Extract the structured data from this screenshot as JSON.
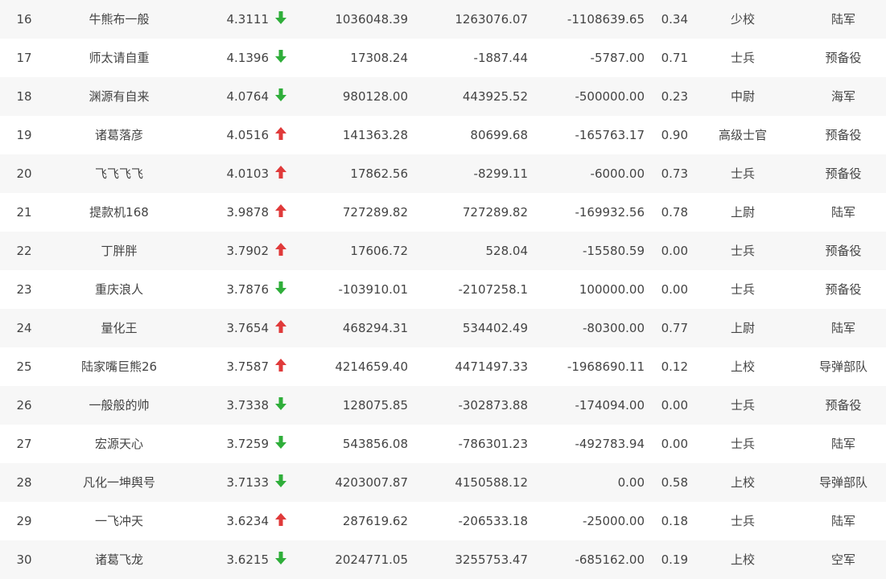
{
  "colors": {
    "up": "#e03a3a",
    "down": "#2fae3a",
    "text": "#444444",
    "row_alt": "#f7f7f7"
  },
  "rows": [
    {
      "rank": "16",
      "name": "牛熊布一般",
      "score": "4.3111",
      "trend": "down",
      "v1": "1036048.39",
      "v2": "1263076.07",
      "v3": "-1108639.65",
      "ratio": "0.34",
      "military_rank": "少校",
      "branch": "陆军"
    },
    {
      "rank": "17",
      "name": "师太请自重",
      "score": "4.1396",
      "trend": "down",
      "v1": "17308.24",
      "v2": "-1887.44",
      "v3": "-5787.00",
      "ratio": "0.71",
      "military_rank": "士兵",
      "branch": "预备役"
    },
    {
      "rank": "18",
      "name": "渊源有自来",
      "score": "4.0764",
      "trend": "down",
      "v1": "980128.00",
      "v2": "443925.52",
      "v3": "-500000.00",
      "ratio": "0.23",
      "military_rank": "中尉",
      "branch": "海军"
    },
    {
      "rank": "19",
      "name": "诸葛落彦",
      "score": "4.0516",
      "trend": "up",
      "v1": "141363.28",
      "v2": "80699.68",
      "v3": "-165763.17",
      "ratio": "0.90",
      "military_rank": "高级士官",
      "branch": "预备役"
    },
    {
      "rank": "20",
      "name": "飞飞飞飞",
      "score": "4.0103",
      "trend": "up",
      "v1": "17862.56",
      "v2": "-8299.11",
      "v3": "-6000.00",
      "ratio": "0.73",
      "military_rank": "士兵",
      "branch": "预备役"
    },
    {
      "rank": "21",
      "name": "提款机168",
      "score": "3.9878",
      "trend": "up",
      "v1": "727289.82",
      "v2": "727289.82",
      "v3": "-169932.56",
      "ratio": "0.78",
      "military_rank": "上尉",
      "branch": "陆军"
    },
    {
      "rank": "22",
      "name": "丁胖胖",
      "score": "3.7902",
      "trend": "up",
      "v1": "17606.72",
      "v2": "528.04",
      "v3": "-15580.59",
      "ratio": "0.00",
      "military_rank": "士兵",
      "branch": "预备役"
    },
    {
      "rank": "23",
      "name": "重庆浪人",
      "score": "3.7876",
      "trend": "down",
      "v1": "-103910.01",
      "v2": "-2107258.1",
      "v3": "100000.00",
      "ratio": "0.00",
      "military_rank": "士兵",
      "branch": "预备役"
    },
    {
      "rank": "24",
      "name": "量化王",
      "score": "3.7654",
      "trend": "up",
      "v1": "468294.31",
      "v2": "534402.49",
      "v3": "-80300.00",
      "ratio": "0.77",
      "military_rank": "上尉",
      "branch": "陆军"
    },
    {
      "rank": "25",
      "name": "陆家嘴巨熊26",
      "score": "3.7587",
      "trend": "up",
      "v1": "4214659.40",
      "v2": "4471497.33",
      "v3": "-1968690.11",
      "ratio": "0.12",
      "military_rank": "上校",
      "branch": "导弹部队"
    },
    {
      "rank": "26",
      "name": "一般般的帅",
      "score": "3.7338",
      "trend": "down",
      "v1": "128075.85",
      "v2": "-302873.88",
      "v3": "-174094.00",
      "ratio": "0.00",
      "military_rank": "士兵",
      "branch": "预备役"
    },
    {
      "rank": "27",
      "name": "宏源天心",
      "score": "3.7259",
      "trend": "down",
      "v1": "543856.08",
      "v2": "-786301.23",
      "v3": "-492783.94",
      "ratio": "0.00",
      "military_rank": "士兵",
      "branch": "陆军"
    },
    {
      "rank": "28",
      "name": "凡化一坤舆号",
      "score": "3.7133",
      "trend": "down",
      "v1": "4203007.87",
      "v2": "4150588.12",
      "v3": "0.00",
      "ratio": "0.58",
      "military_rank": "上校",
      "branch": "导弹部队"
    },
    {
      "rank": "29",
      "name": "一飞冲天",
      "score": "3.6234",
      "trend": "up",
      "v1": "287619.62",
      "v2": "-206533.18",
      "v3": "-25000.00",
      "ratio": "0.18",
      "military_rank": "士兵",
      "branch": "陆军"
    },
    {
      "rank": "30",
      "name": "诸葛飞龙",
      "score": "3.6215",
      "trend": "down",
      "v1": "2024771.05",
      "v2": "3255753.47",
      "v3": "-685162.00",
      "ratio": "0.19",
      "military_rank": "上校",
      "branch": "空军"
    }
  ]
}
